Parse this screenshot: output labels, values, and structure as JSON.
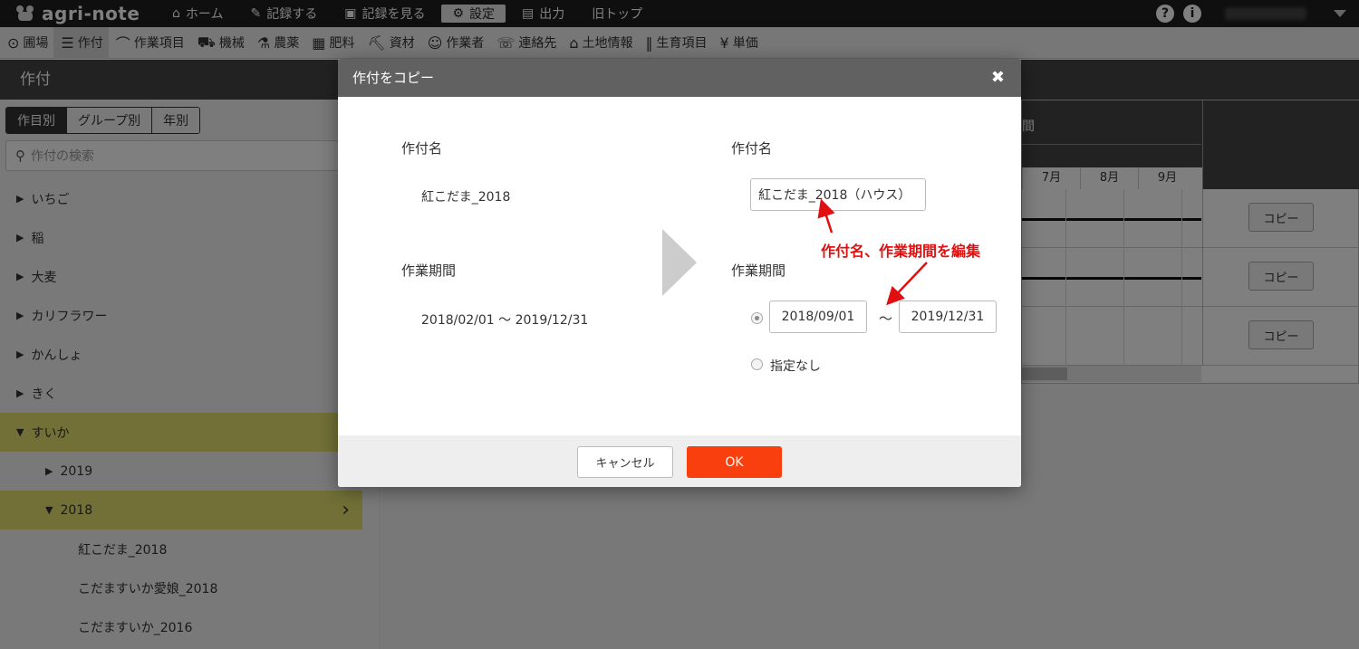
{
  "app": {
    "logo_text": "agri-note"
  },
  "topnav": [
    {
      "icon": "home-icon",
      "glyph": "⌂",
      "label": "ホーム"
    },
    {
      "icon": "pencil-icon",
      "glyph": "✎",
      "label": "記録する"
    },
    {
      "icon": "book-icon",
      "glyph": "▣",
      "label": "記録を見る"
    },
    {
      "icon": "gear-icon",
      "glyph": "⚙",
      "label": "設定",
      "active": true
    },
    {
      "icon": "document-icon",
      "glyph": "▤",
      "label": "出力"
    },
    {
      "icon": "",
      "glyph": "",
      "label": "旧トップ"
    }
  ],
  "subnav": [
    {
      "icon": "pin-icon",
      "glyph": "⊙",
      "label": "圃場"
    },
    {
      "icon": "list-icon",
      "glyph": "☰",
      "label": "作付",
      "active": true
    },
    {
      "icon": "sickle-icon",
      "glyph": "⌒",
      "label": "作業項目"
    },
    {
      "icon": "tractor-icon",
      "glyph": "⛟",
      "label": "機械"
    },
    {
      "icon": "flask-icon",
      "glyph": "⚗",
      "label": "農薬"
    },
    {
      "icon": "npk-icon",
      "glyph": "▦",
      "label": "肥料"
    },
    {
      "icon": "wheelbarrow-icon",
      "glyph": "⛏",
      "label": "資材"
    },
    {
      "icon": "worker-icon",
      "glyph": "☺",
      "label": "作業者"
    },
    {
      "icon": "phonebook-icon",
      "glyph": "☏",
      "label": "連絡先"
    },
    {
      "icon": "land-icon",
      "glyph": "⌂",
      "label": "土地情報"
    },
    {
      "icon": "sprout-icon",
      "glyph": "‖",
      "label": "生育項目"
    },
    {
      "icon": "yen-icon",
      "glyph": "¥",
      "label": "単価"
    }
  ],
  "page_title": "作付",
  "sidebar": {
    "segments": [
      "作目別",
      "グループ別",
      "年別"
    ],
    "search_placeholder": "作付の検索",
    "tree": [
      {
        "label": "いちご",
        "tri": "▶",
        "indent": 18
      },
      {
        "label": "稲",
        "tri": "▶",
        "indent": 18
      },
      {
        "label": "大麦",
        "tri": "▶",
        "indent": 18
      },
      {
        "label": "カリフラワー",
        "tri": "▶",
        "indent": 18
      },
      {
        "label": "かんしょ",
        "tri": "▶",
        "indent": 18
      },
      {
        "label": "きく",
        "tri": "▶",
        "indent": 18
      },
      {
        "label": "すいか",
        "tri": "▼",
        "indent": 18,
        "highlight": true
      },
      {
        "label": "2019",
        "tri": "▶",
        "indent": 50
      },
      {
        "label": "2018",
        "tri": "▼",
        "indent": 50,
        "highlight": true,
        "chevron": "›"
      },
      {
        "label": "紅こだま_2018",
        "tri": "",
        "indent": 86
      },
      {
        "label": "こだますいか愛娘_2018",
        "tri": "",
        "indent": 86
      },
      {
        "label": "こだますいか_2016",
        "tri": "",
        "indent": 86
      }
    ]
  },
  "grid": {
    "header_partial": "間",
    "months": [
      "7月",
      "8月",
      "9月"
    ],
    "copy_label": "コピー"
  },
  "modal": {
    "title": "作付をコピー",
    "close_glyph": "✖",
    "left": {
      "name_label": "作付名",
      "name_value": "紅こだま_2018",
      "period_label": "作業期間",
      "period_value": "2018/02/01 〜 2019/12/31"
    },
    "right": {
      "name_label": "作付名",
      "name_input": "紅こだま_2018（ハウス）",
      "period_label": "作業期間",
      "start_date": "2018/09/01",
      "tilde": "〜",
      "end_date": "2019/12/31",
      "no_period_label": "指定なし"
    },
    "cancel_label": "キャンセル",
    "ok_label": "OK"
  },
  "annotation": {
    "text": "作付名、作業期間を編集",
    "color": "#e01010"
  },
  "colors": {
    "ok_button": "#fa3f0f",
    "highlight_row": "#e5e16e",
    "topbar": "#1e1e1e"
  }
}
